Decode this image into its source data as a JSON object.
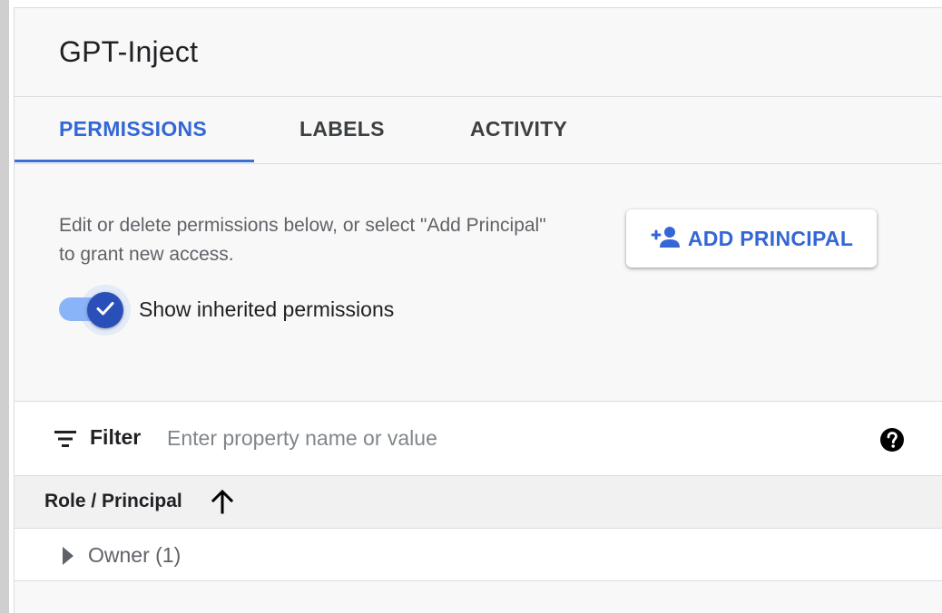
{
  "page": {
    "title": "GPT-Inject"
  },
  "tabs": [
    {
      "label": "PERMISSIONS",
      "active": true
    },
    {
      "label": "LABELS",
      "active": false
    },
    {
      "label": "ACTIVITY",
      "active": false
    }
  ],
  "permissions": {
    "description": "Edit or delete permissions below, or select \"Add Principal\" to grant new access.",
    "add_button_label": "ADD PRINCIPAL",
    "add_button_icon": "person-add-icon",
    "toggle_label": "Show inherited permissions",
    "toggle_checked": true
  },
  "filter": {
    "label": "Filter",
    "placeholder": "Enter property name or value",
    "value": "",
    "help_icon": "help-circle-icon"
  },
  "table": {
    "column_header": "Role / Principal",
    "sort_direction": "ascending",
    "rows": [
      {
        "label": "Owner (1)",
        "expanded": false
      }
    ]
  },
  "colors": {
    "accent": "#3367d6",
    "toggle_knob": "#2a4fb8",
    "toggle_track": "#8ab4f8",
    "text_primary": "#202124",
    "text_secondary": "#5f6368"
  }
}
